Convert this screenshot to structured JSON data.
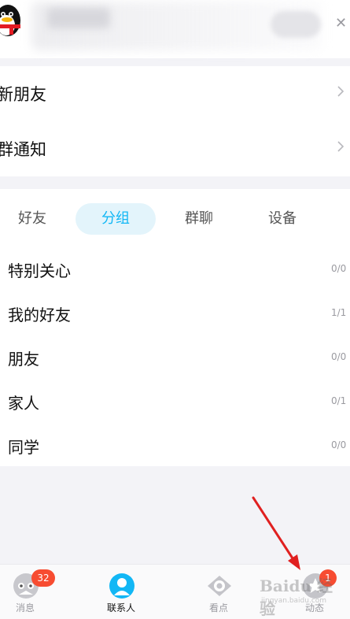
{
  "notifications": {
    "new_friends": "新朋友",
    "group_notice": "群通知"
  },
  "tabs": [
    {
      "label": "好友",
      "active": false
    },
    {
      "label": "分组",
      "active": true
    },
    {
      "label": "群聊",
      "active": false
    },
    {
      "label": "设备",
      "active": false
    }
  ],
  "groups": [
    {
      "name": "特别关心",
      "count": "0/0"
    },
    {
      "name": "我的好友",
      "count": "1/1"
    },
    {
      "name": "朋友",
      "count": "0/0"
    },
    {
      "name": "家人",
      "count": "0/1"
    },
    {
      "name": "同学",
      "count": "0/0"
    }
  ],
  "bottom_nav": {
    "messages": {
      "label": "消息",
      "badge": "32",
      "icon": "chat-bubble-icon"
    },
    "contacts": {
      "label": "联系人",
      "icon": "contact-person-icon",
      "active": true
    },
    "watch": {
      "label": "看点",
      "icon": "eye-icon"
    },
    "updates": {
      "label": "动态",
      "badge": "1",
      "icon": "star-icon"
    }
  },
  "watermark": {
    "line1": "Baidu 经验",
    "line2": "jingyan.baidu.com"
  },
  "colors": {
    "accent": "#12b7f5",
    "active_tab_bg": "#e3f4fb",
    "badge": "#f74c31",
    "annotation_arrow": "#e02020"
  }
}
